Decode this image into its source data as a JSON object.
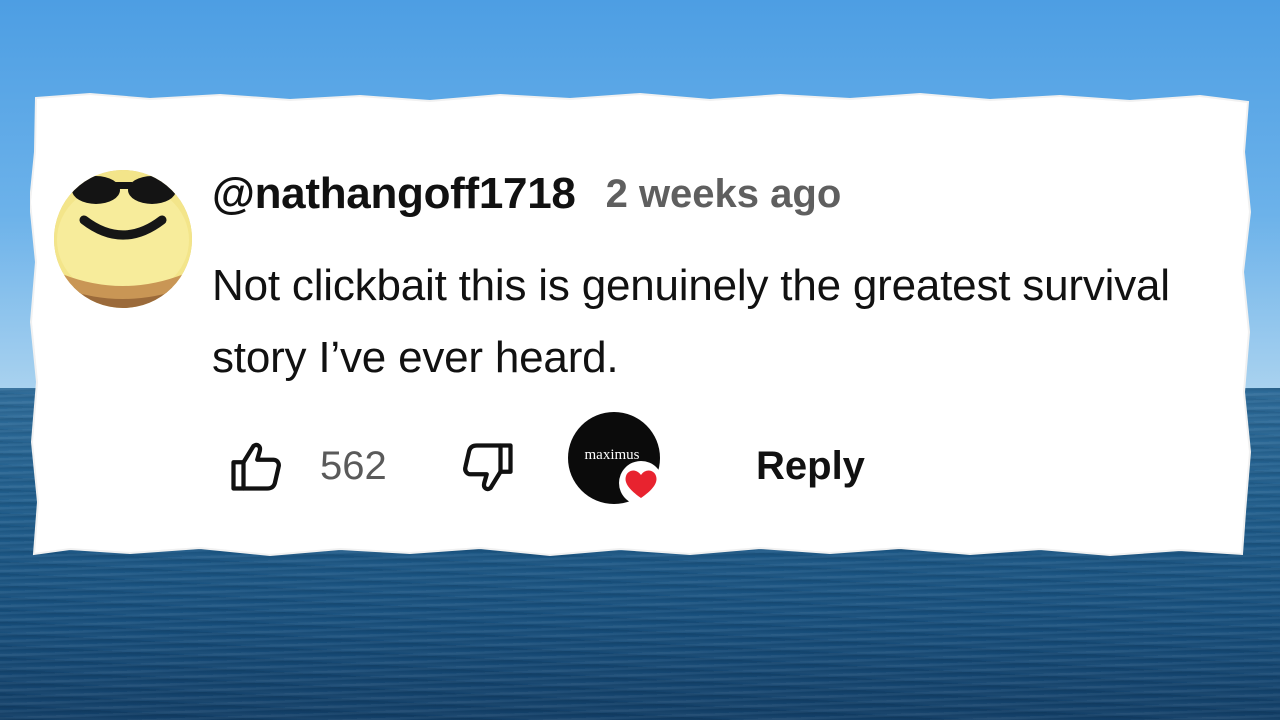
{
  "comment": {
    "username": "@nathangoff1718",
    "timestamp": "2 weeks ago",
    "text": "Not clickbait this is genuinely the greatest survival story I’ve ever heard.",
    "likes": "562",
    "reply_label": "Reply"
  },
  "creator_heart": {
    "creator_name": "maximus",
    "heart_color": "#e8232f"
  },
  "icons": {
    "avatar": "sunglasses-smiley-avatar",
    "like": "thumbs-up-icon",
    "dislike": "thumbs-down-icon",
    "heart": "heart-icon"
  },
  "colors": {
    "text": "#111111",
    "muted": "#5f5f5f",
    "card": "#ffffff",
    "sky": "#4d9ee3",
    "sea": "#1f5d8c"
  }
}
